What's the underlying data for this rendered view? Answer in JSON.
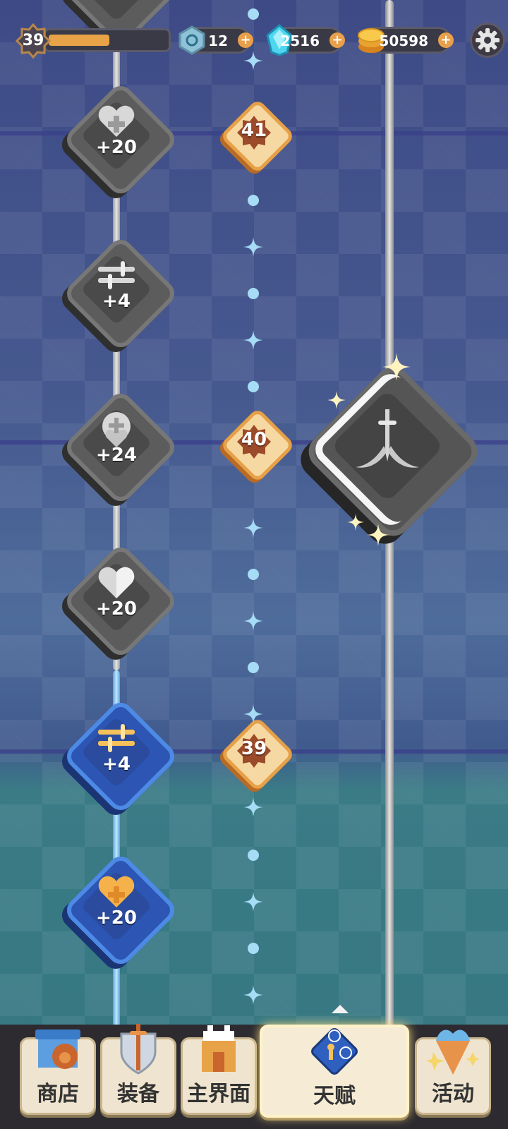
{
  "hud": {
    "player_level": "39",
    "xp_progress": 0.52,
    "gems_blue": "12",
    "diamonds": "2516",
    "coins": "50598",
    "plus": "+"
  },
  "talent_nodes": [
    {
      "label": "+20",
      "icon": "heart-icon",
      "state": "locked"
    },
    {
      "label": "+4",
      "icon": "sword-icon",
      "state": "locked"
    },
    {
      "label": "+24",
      "icon": "shield-heart-icon",
      "state": "locked"
    },
    {
      "label": "+20",
      "icon": "heart-icon",
      "state": "locked"
    },
    {
      "label": "+4",
      "icon": "sword-icon",
      "state": "unlocked"
    },
    {
      "label": "+20",
      "icon": "heart-icon",
      "state": "unlocked"
    }
  ],
  "level_markers": [
    "41",
    "40",
    "39"
  ],
  "big_talent": {
    "icon": "crossed-swords-icon",
    "state": "locked"
  },
  "nav": {
    "shop": "商店",
    "equipment": "装备",
    "main": "主界面",
    "talent": "天赋",
    "activity": "活动",
    "selected": "talent"
  },
  "colors": {
    "accent": "#e8a348",
    "locked": "#5c5c5c",
    "unlocked": "#2c55b4"
  }
}
